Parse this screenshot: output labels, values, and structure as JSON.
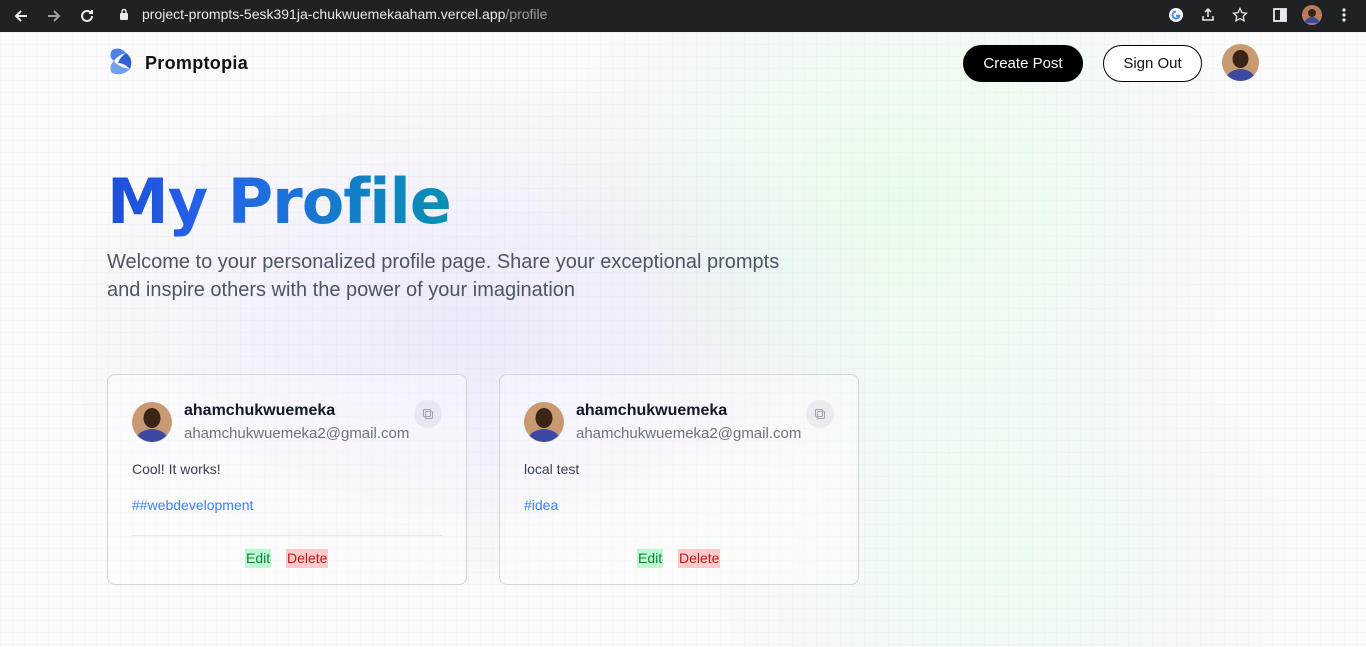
{
  "browser": {
    "url_host": "project-prompts-5esk391ja-chukwuemekaaham.vercel.app",
    "url_path": "/profile"
  },
  "header": {
    "brand": "Promptopia",
    "create_post": "Create Post",
    "sign_out": "Sign Out"
  },
  "hero": {
    "title": "My Profile",
    "description": "Welcome to your personalized profile page. Share your exceptional prompts and inspire others with the power of your imagination"
  },
  "posts": [
    {
      "username": "ahamchukwuemeka",
      "email": "ahamchukwuemeka2@gmail.com",
      "prompt": "Cool! It works!",
      "tag": "##webdevelopment",
      "edit": "Edit",
      "delete": "Delete"
    },
    {
      "username": "ahamchukwuemeka",
      "email": "ahamchukwuemeka2@gmail.com",
      "prompt": "local test",
      "tag": "#idea",
      "edit": "Edit",
      "delete": "Delete"
    }
  ],
  "colors": {
    "accent_blue": "#2563eb",
    "tag_blue": "#3b82f6",
    "edit_bg": "#bbf7d0",
    "delete_bg": "#fecaca"
  }
}
